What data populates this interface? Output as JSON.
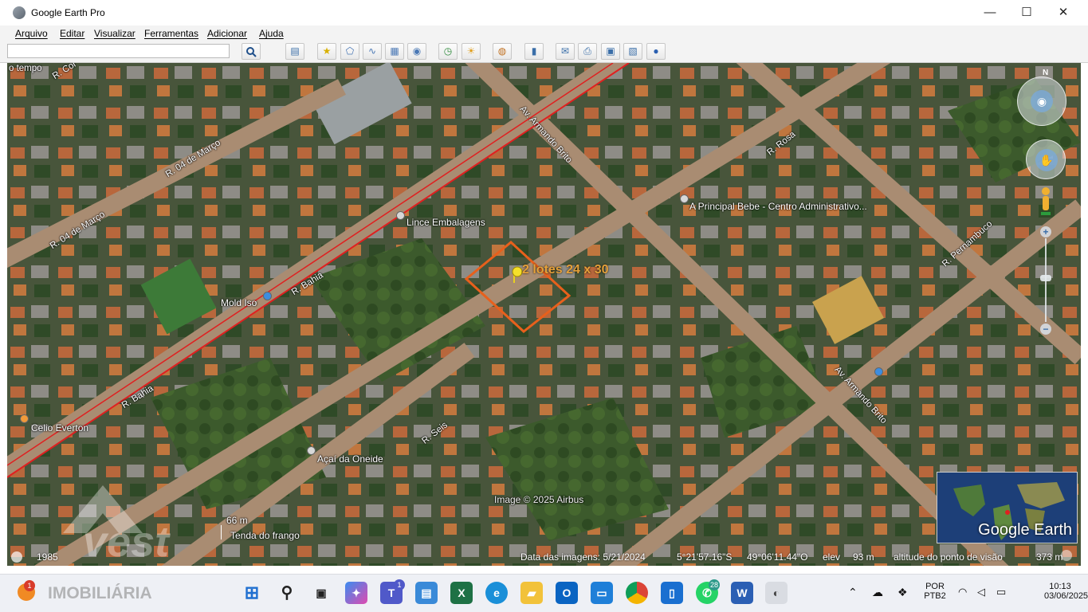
{
  "window": {
    "title": "Google Earth Pro",
    "controls": {
      "minimize": "—",
      "maximize": "☐",
      "close": "✕"
    }
  },
  "menu": [
    "Arquivo",
    "Editar",
    "Visualizar",
    "Ferramentas",
    "Adicionar",
    "Ajuda"
  ],
  "search": {
    "value": "",
    "icon": "search-icon"
  },
  "toolbar": {
    "icons": [
      "sidebar-toggle-icon",
      "placemark-icon",
      "polygon-icon",
      "path-icon",
      "image-overlay-icon",
      "record-tour-icon",
      "historical-imagery-icon",
      "sunlight-icon",
      "planets-icon",
      "ruler-icon",
      "email-icon",
      "print-icon",
      "save-image-icon",
      "view-in-maps-icon",
      "earth-gallery-icon"
    ]
  },
  "map": {
    "placemark_label": "2 lotes 24 x 30",
    "pois": [
      "Lince Embalagens",
      "Mold Iso",
      "A Principal Bebe - Centro Administrativo...",
      "Celio Everton",
      "Açaí da Oneide",
      "Tenda do frango"
    ],
    "roads": [
      "R. Bahia",
      "R. Bahia",
      "R. 04 de Março",
      "R. 04 de Março",
      "Av. Armando Brito",
      "Av. Armando Brito",
      "R. Seis",
      "R. Rosa",
      "R. Pernambuco"
    ],
    "edge_fragments": [
      "o tempo",
      "R. Cor"
    ],
    "scale": "66 m",
    "copyright": "Image © 2025 Airbus",
    "logo": "Google Earth",
    "compass_north": "N",
    "imagery_year": "1985",
    "watermark": {
      "brand": "vest",
      "sub": "IMOBILIÁRIA"
    }
  },
  "status_bar": {
    "date": "Data das imagens: 5/21/2024",
    "lat": "5°21'57.16\"S",
    "lon": "49°06'11.44\"O",
    "elev_label": "elev",
    "elev": "93 m",
    "eye_label": "altitude do ponto de visão",
    "eye": "373 m"
  },
  "taskbar": {
    "apps": [
      "start-icon",
      "search-icon",
      "task-view-icon",
      "copilot-icon",
      "teams-icon",
      "widgets-icon",
      "excel-icon",
      "edge-icon",
      "file-explorer-icon",
      "outlook-icon",
      "remote-desktop-icon",
      "chrome-icon",
      "computer-icon",
      "whatsapp-icon",
      "word-icon",
      "google-earth-icon"
    ],
    "badges": {
      "notifications": "1",
      "teams": "1",
      "whatsapp": "28"
    },
    "language": "POR",
    "layout": "PTB2",
    "time": "10:13",
    "date": "03/06/2025"
  },
  "colors": {
    "placemark": "#e8601c",
    "road_line": "#e02020",
    "map_bg": "#3d4a33"
  }
}
